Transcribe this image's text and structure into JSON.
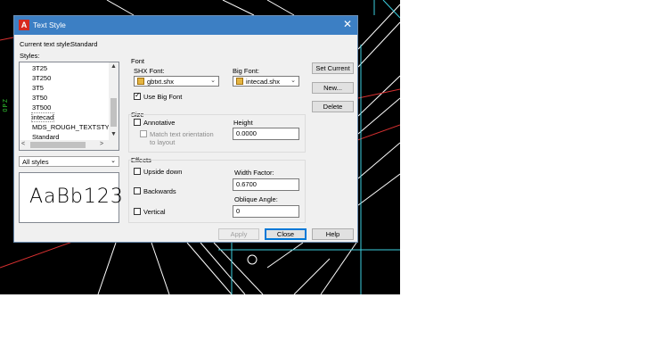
{
  "background": {
    "side_text": "OPZ"
  },
  "dialog": {
    "title": "Text Style",
    "current_style_label": "Current text style:",
    "current_style_value": "Standard",
    "styles_label": "Styles:",
    "styles": [
      "3T25",
      "3T250",
      "3T5",
      "3T50",
      "3T500",
      "intecad",
      "MDS_ROUGH_TEXTSTY...",
      "Standard"
    ],
    "selected_style": "intecad",
    "filter": "All styles",
    "preview_text": "AaBb123",
    "font": {
      "group_title": "Font",
      "shx_label": "SHX Font:",
      "shx_value": "gbtxt.shx",
      "big_label": "Big Font:",
      "big_value": "intecad.shx",
      "use_big_font": "Use Big Font",
      "use_big_font_checked": true
    },
    "size": {
      "group_title": "Size",
      "annotative": "Annotative",
      "match_orientation": "Match text orientation to layout",
      "height_label": "Height",
      "height_value": "0.0000"
    },
    "effects": {
      "group_title": "Effects",
      "upside_down": "Upside down",
      "backwards": "Backwards",
      "vertical": "Vertical",
      "width_label": "Width Factor:",
      "width_value": "0.6700",
      "oblique_label": "Oblique Angle:",
      "oblique_value": "0"
    },
    "buttons": {
      "set_current": "Set Current",
      "new": "New...",
      "delete": "Delete",
      "apply": "Apply",
      "close": "Close",
      "help": "Help"
    }
  },
  "colors": {
    "titlebar": "#3c7fc4",
    "cad_bg": "#000000"
  }
}
